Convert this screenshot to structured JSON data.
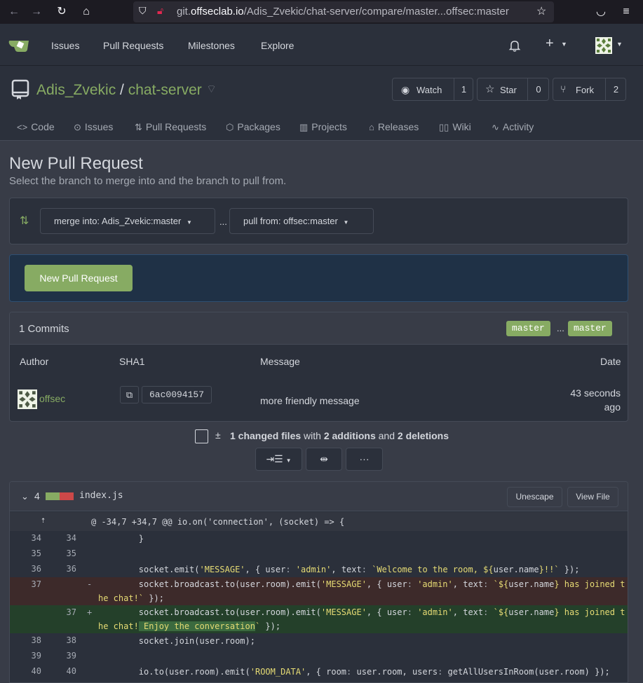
{
  "browser": {
    "url_prefix": "git.",
    "url_domain": "offseclab.io",
    "url_path": "/Adis_Zvekic/chat-server/compare/master...offsec:master"
  },
  "header": {
    "nav": [
      "Issues",
      "Pull Requests",
      "Milestones",
      "Explore"
    ]
  },
  "repo": {
    "owner": "Adis_Zvekic",
    "separator": "/",
    "name": "chat-server",
    "watch_label": "Watch",
    "watch_count": "1",
    "star_label": "Star",
    "star_count": "0",
    "fork_label": "Fork",
    "fork_count": "2"
  },
  "tabs": [
    "Code",
    "Issues",
    "Pull Requests",
    "Packages",
    "Projects",
    "Releases",
    "Wiki",
    "Activity"
  ],
  "page": {
    "title": "New Pull Request",
    "subtitle": "Select the branch to merge into and the branch to pull from.",
    "merge_into": "merge into: Adis_Zvekic:master",
    "dots": "...",
    "pull_from": "pull from: offsec:master",
    "new_pr_button": "New Pull Request"
  },
  "commits": {
    "count_label": "1 Commits",
    "base_branch": "master",
    "head_branch": "master",
    "branch_dots": "...",
    "columns": {
      "author": "Author",
      "sha": "SHA1",
      "message": "Message",
      "date": "Date"
    },
    "rows": [
      {
        "author": "offsec",
        "sha": "6ac0094157",
        "message": "more friendly message",
        "date_line1": "43 seconds",
        "date_line2": "ago"
      }
    ]
  },
  "diff_summary": {
    "changed": "1 changed files",
    "with": "with",
    "additions": "2 additions",
    "and": "and",
    "deletions": "2 deletions"
  },
  "file": {
    "change_count": "4",
    "name": "index.js",
    "unescape_button": "Unescape",
    "view_file_button": "View File",
    "hunk_header": "@ -34,7 +34,7 @@ io.on('connection', (socket) => {"
  },
  "colors": {
    "accent": "#87ab63",
    "added": "#24402a",
    "deleted": "#3d2a2a"
  }
}
